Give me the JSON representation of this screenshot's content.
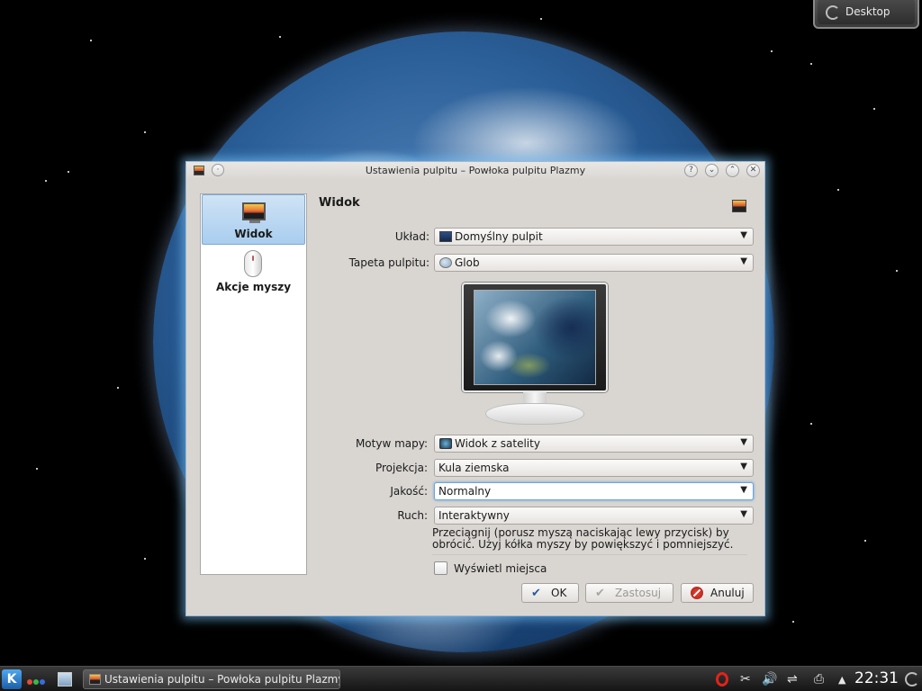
{
  "desktop_widget": {
    "label": "Desktop"
  },
  "window": {
    "title": "Ustawienia pulpitu – Powłoka pulpitu Plazmy",
    "buttons": {
      "help": "?",
      "shade": "⌄",
      "maximize": "⌃",
      "close": "✕"
    }
  },
  "sidebar": {
    "items": [
      {
        "label": "Widok",
        "selected": true,
        "icon": "monitor-icon"
      },
      {
        "label": "Akcje myszy",
        "selected": false,
        "icon": "mouse-icon"
      }
    ]
  },
  "main": {
    "section_title": "Widok",
    "layout": {
      "label": "Układ:",
      "value": "Domyślny pulpit"
    },
    "wallpaper": {
      "label": "Tapeta pulpitu:",
      "value": "Glob"
    },
    "map_theme": {
      "label": "Motyw mapy:",
      "value": "Widok z satelity"
    },
    "projection": {
      "label": "Projekcja:",
      "value": "Kula ziemska"
    },
    "quality": {
      "label": "Jakość:",
      "value": "Normalny"
    },
    "movement": {
      "label": "Ruch:",
      "value": "Interaktywny"
    },
    "hint": "Przeciągnij (porusz myszą naciskając lewy przycisk) by obrócić. Użyj kółka myszy by powiększyć i pomniejszyć.",
    "show_places": {
      "label": "Wyświetl miejsca",
      "checked": false
    }
  },
  "buttons": {
    "ok": "OK",
    "apply": "Zastosuj",
    "cancel": "Anuluj"
  },
  "taskbar": {
    "k_menu": "K",
    "task_title": "Ustawienia pulpitu – Powłoka pulpitu Plazmy",
    "clock": "22:31",
    "tray_icons": [
      "opera-icon",
      "scissors-icon",
      "volume-icon",
      "network-icon",
      "printer-icon",
      "expand-arrow-icon"
    ]
  },
  "colors": {
    "accent": "#a9cdef",
    "window_bg": "#d9d6d2",
    "glow": "#78c8ff"
  }
}
